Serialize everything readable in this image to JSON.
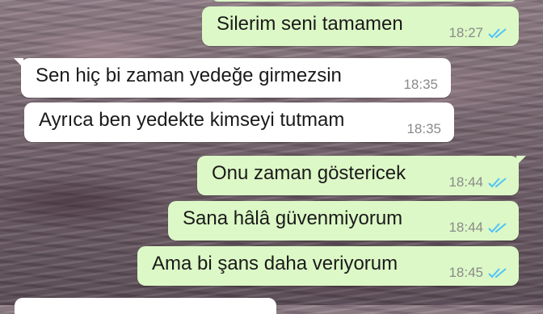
{
  "chat": {
    "messages": [
      {
        "direction": "outgoing",
        "text": "Silerim seni tamamen",
        "time": "18:27",
        "status": "read"
      },
      {
        "direction": "incoming",
        "text": "Sen hiç bi zaman yedeğe girmezsin",
        "time": "18:35"
      },
      {
        "direction": "incoming",
        "text": "Ayrıca ben yedekte kimseyi tutmam",
        "time": "18:35"
      },
      {
        "direction": "outgoing",
        "text": "Onu zaman göstericek",
        "time": "18:44",
        "status": "read"
      },
      {
        "direction": "outgoing",
        "text": "Sana hâlâ güvenmiyorum",
        "time": "18:44",
        "status": "read"
      },
      {
        "direction": "outgoing",
        "text": "Ama bi şans daha veriyorum",
        "time": "18:45",
        "status": "read"
      }
    ]
  },
  "colors": {
    "incoming_bubble": "#ffffff",
    "outgoing_bubble": "#dcf8c6",
    "read_ticks": "#4fc3f7",
    "timestamp": "#8a8a8a"
  },
  "icons": {
    "read_receipt": "double-check-icon"
  }
}
